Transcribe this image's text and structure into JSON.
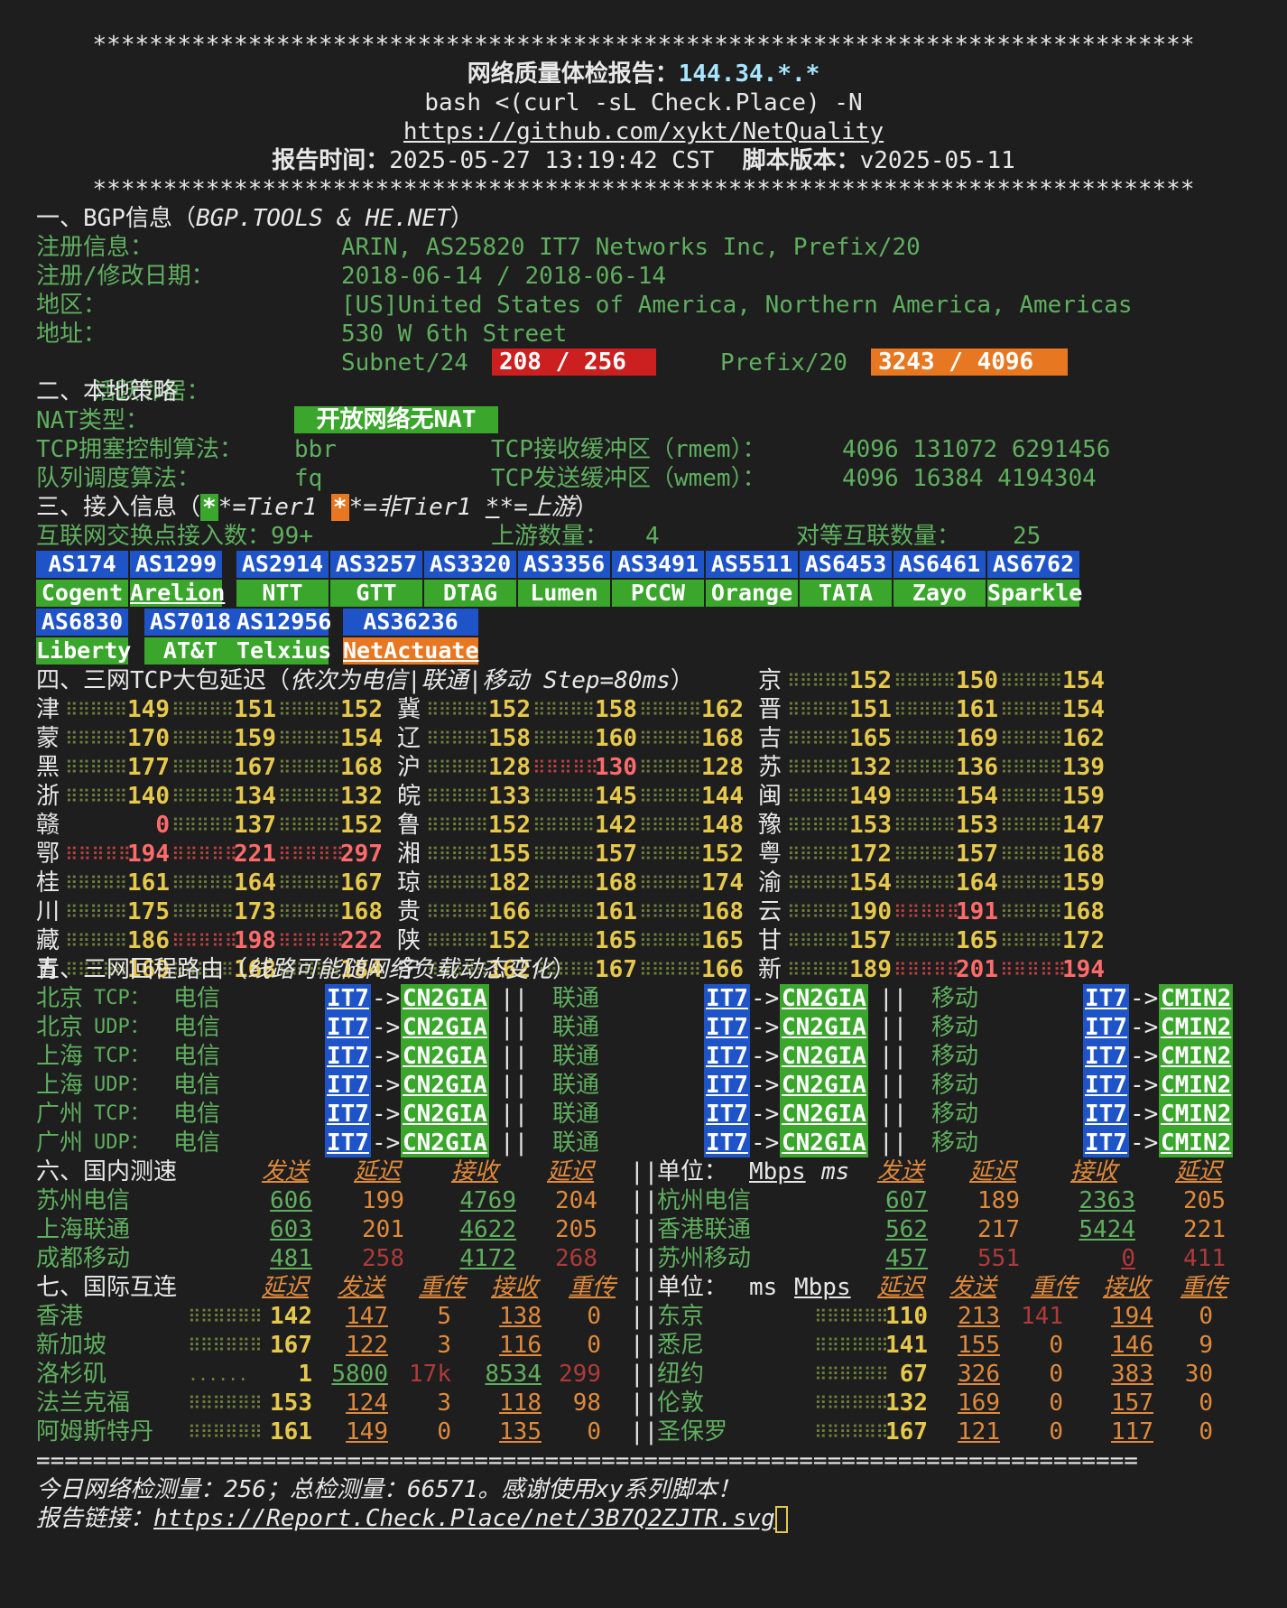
{
  "header": {
    "stars": "******************************************************************************",
    "title": "网络质量体检报告：",
    "ip": "144.34.*.*",
    "command": "bash <(curl -sL Check.Place) -N",
    "repo": "https://github.com/xykt/NetQuality",
    "time_label": "报告时间：",
    "time": "2025-05-27 13:19:42 CST",
    "version_label": "脚本版本：",
    "version": "v2025-05-11"
  },
  "bgp": {
    "title": "一、BGP信息（",
    "source": "BGP.TOOLS & HE.NET",
    "title_end": "）",
    "reg_label": "注册信息：",
    "reg": "ARIN, AS25820 IT7 Networks Inc, Prefix/20",
    "date_label": "注册/修改日期：",
    "date": "2018-06-14 / 2018-06-14",
    "region_label": "地区：",
    "region": "[US]United States of America, Northern America, Americas",
    "addr_label": "地址：",
    "addr": "530 W 6th Street",
    "neighbor_label": "活跃邻居：",
    "subnet_label": "Subnet/24",
    "subnet_val": "208 / 256",
    "prefix_label": "Prefix/20",
    "prefix_val": "3243 / 4096"
  },
  "local": {
    "title": "二、本地策略",
    "nat_label": "NAT类型：",
    "nat": "开放网络无NAT",
    "tcp_cc_label": "TCP拥塞控制算法：",
    "tcp_cc": "bbr",
    "rmem_label": "TCP接收缓冲区（rmem）：",
    "rmem": "4096 131072 6291456",
    "qdisc_label": "队列调度算法：",
    "qdisc": "fq",
    "wmem_label": "TCP发送缓冲区（wmem）：",
    "wmem": "4096 16384 4194304"
  },
  "access": {
    "title": "三、接入信息（",
    "legend_a": "*=Tier1 ",
    "legend_b": "*=非Tier1 ",
    "legend_c": "*=上游",
    "title_end": "）",
    "ix_label": "互联网交换点接入数：",
    "ix": "99+",
    "up_label": "上游数量：",
    "up": "4",
    "peer_label": "对等互联数量：",
    "peer": "25",
    "asns": [
      {
        "as": "AS174",
        "name": "Cogent"
      },
      {
        "as": "AS1299",
        "name": "Arelion"
      },
      {
        "as": "AS2914",
        "name": "NTT"
      },
      {
        "as": "AS3257",
        "name": "GTT"
      },
      {
        "as": "AS3320",
        "name": "DTAG"
      },
      {
        "as": "AS3356",
        "name": "Lumen"
      },
      {
        "as": "AS3491",
        "name": "PCCW"
      },
      {
        "as": "AS5511",
        "name": "Orange"
      },
      {
        "as": "AS6453",
        "name": "TATA"
      },
      {
        "as": "AS6461",
        "name": "Zayo"
      },
      {
        "as": "AS6762",
        "name": "Sparkle"
      },
      {
        "as": "AS6830",
        "name": "Liberty"
      },
      {
        "as": "AS7018",
        "name": "AT&T"
      },
      {
        "as": "AS12956",
        "name": "Telxius"
      },
      {
        "as": "AS36236",
        "name": "NetActuate"
      }
    ]
  },
  "latency": {
    "title": "四、三网TCP大包延迟（",
    "title_it": "依次为电信|联通|移动 Step=80ms",
    "title_end": "）",
    "rows": [
      [
        {
          "p": "京",
          "v": [
            "152",
            "150",
            "154"
          ]
        }
      ],
      [
        {
          "p": "津",
          "v": [
            "149",
            "151",
            "152"
          ]
        },
        {
          "p": "冀",
          "v": [
            "152",
            "158",
            "162"
          ]
        },
        {
          "p": "晋",
          "v": [
            "151",
            "161",
            "154"
          ]
        }
      ],
      [
        {
          "p": "蒙",
          "v": [
            "170",
            "159",
            "154"
          ]
        },
        {
          "p": "辽",
          "v": [
            "158",
            "160",
            "168"
          ]
        },
        {
          "p": "吉",
          "v": [
            "165",
            "169",
            "162"
          ]
        }
      ],
      [
        {
          "p": "黑",
          "v": [
            "177",
            "167",
            "168"
          ]
        },
        {
          "p": "沪",
          "v": [
            "128",
            "130",
            "128"
          ]
        },
        {
          "p": "苏",
          "v": [
            "132",
            "136",
            "139"
          ]
        }
      ],
      [
        {
          "p": "浙",
          "v": [
            "140",
            "134",
            "132"
          ]
        },
        {
          "p": "皖",
          "v": [
            "133",
            "145",
            "144"
          ]
        },
        {
          "p": "闽",
          "v": [
            "149",
            "154",
            "159"
          ]
        }
      ],
      [
        {
          "p": "赣",
          "v": [
            "0",
            "137",
            "152"
          ]
        },
        {
          "p": "鲁",
          "v": [
            "152",
            "142",
            "148"
          ]
        },
        {
          "p": "豫",
          "v": [
            "153",
            "153",
            "147"
          ]
        }
      ],
      [
        {
          "p": "鄂",
          "v": [
            "194",
            "221",
            "297"
          ]
        },
        {
          "p": "湘",
          "v": [
            "155",
            "157",
            "152"
          ]
        },
        {
          "p": "粤",
          "v": [
            "172",
            "157",
            "168"
          ]
        }
      ],
      [
        {
          "p": "桂",
          "v": [
            "161",
            "164",
            "167"
          ]
        },
        {
          "p": "琼",
          "v": [
            "182",
            "168",
            "174"
          ]
        },
        {
          "p": "渝",
          "v": [
            "154",
            "164",
            "159"
          ]
        }
      ],
      [
        {
          "p": "川",
          "v": [
            "175",
            "173",
            "168"
          ]
        },
        {
          "p": "贵",
          "v": [
            "166",
            "161",
            "168"
          ]
        },
        {
          "p": "云",
          "v": [
            "190",
            "191",
            "168"
          ]
        }
      ],
      [
        {
          "p": "藏",
          "v": [
            "186",
            "198",
            "222"
          ]
        },
        {
          "p": "陕",
          "v": [
            "152",
            "165",
            "165"
          ]
        },
        {
          "p": "甘",
          "v": [
            "157",
            "165",
            "172"
          ]
        }
      ],
      [
        {
          "p": "青",
          "v": [
            "169",
            "168",
            "184"
          ]
        },
        {
          "p": "宁",
          "v": [
            "162",
            "167",
            "166"
          ]
        },
        {
          "p": "新",
          "v": [
            "189",
            "201",
            "194"
          ]
        }
      ]
    ]
  },
  "route": {
    "title": "五、三网回程路由（",
    "title_it": "线路可能随网络负载动态变化",
    "title_end": "）",
    "rows": [
      {
        "city": "北京",
        "proto": "TCP："
      },
      {
        "city": "北京",
        "proto": "UDP："
      },
      {
        "city": "上海",
        "proto": "TCP："
      },
      {
        "city": "上海",
        "proto": "UDP："
      },
      {
        "city": "广州",
        "proto": "TCP："
      },
      {
        "city": "广州",
        "proto": "UDP："
      }
    ],
    "ct": "电信",
    "cu": "联通",
    "cm": "移动",
    "it7": "IT7",
    "arrow": "->",
    "cn2": "CN2GIA",
    "cmin2": "CMIN2",
    "sep": "||"
  },
  "domestic": {
    "title": "六、国内测速",
    "h_send": "发送",
    "h_lat": "延迟",
    "h_recv": "接收",
    "h_lat2": "延迟",
    "unit_label": "单位：",
    "unit_a": "Mbps",
    "unit_b": "ms",
    "left": [
      {
        "n": "苏州电信",
        "s": "606",
        "l": "199",
        "r": "4769",
        "l2": "204"
      },
      {
        "n": "上海联通",
        "s": "603",
        "l": "201",
        "r": "4622",
        "l2": "205"
      },
      {
        "n": "成都移动",
        "s": "481",
        "l": "258",
        "r": "4172",
        "l2": "268"
      }
    ],
    "right": [
      {
        "n": "杭州电信",
        "s": "607",
        "l": "189",
        "r": "2363",
        "l2": "205"
      },
      {
        "n": "香港联通",
        "s": "562",
        "l": "217",
        "r": "5424",
        "l2": "221"
      },
      {
        "n": "苏州移动",
        "s": "457",
        "l": "551",
        "r": "0",
        "l2": "411"
      }
    ]
  },
  "intl": {
    "title": "七、国际互连",
    "h_lat": "延迟",
    "h_send": "发送",
    "h_rt": "重传",
    "h_recv": "接收",
    "h_rt2": "重传",
    "unit_label": "单位：",
    "unit_a": "ms",
    "unit_b": "Mbps",
    "left": [
      {
        "n": "香港",
        "lat": "142",
        "s": "147",
        "rt": "5",
        "r": "138",
        "rt2": "0"
      },
      {
        "n": "新加坡",
        "lat": "167",
        "s": "122",
        "rt": "3",
        "r": "116",
        "rt2": "0"
      },
      {
        "n": "洛杉矶",
        "lat": "1",
        "s": "5800",
        "rt": "17k",
        "r": "8534",
        "rt2": "299"
      },
      {
        "n": "法兰克福",
        "lat": "153",
        "s": "124",
        "rt": "3",
        "r": "118",
        "rt2": "98"
      },
      {
        "n": "阿姆斯特丹",
        "lat": "161",
        "s": "149",
        "rt": "0",
        "r": "135",
        "rt2": "0"
      }
    ],
    "right": [
      {
        "n": "东京",
        "lat": "110",
        "s": "213",
        "rt": "141",
        "r": "194",
        "rt2": "0"
      },
      {
        "n": "悉尼",
        "lat": "141",
        "s": "155",
        "rt": "0",
        "r": "146",
        "rt2": "9"
      },
      {
        "n": "纽约",
        "lat": "67",
        "s": "326",
        "rt": "0",
        "r": "383",
        "rt2": "30"
      },
      {
        "n": "伦敦",
        "lat": "132",
        "s": "169",
        "rt": "0",
        "r": "157",
        "rt2": "0"
      },
      {
        "n": "圣保罗",
        "lat": "167",
        "s": "121",
        "rt": "0",
        "r": "117",
        "rt2": "0"
      }
    ]
  },
  "footer": {
    "rule": "==============================================================================",
    "stats": "今日网络检测量：256；总检测量：66571。感谢使用xy系列脚本！",
    "link_label": "报告链接：",
    "link": "https://Report.Check.Place/net/3B7Q2ZJTR.svg"
  },
  "colors": {
    "bg": "#1e1e1e",
    "green": "#5faf5f",
    "yellow": "#e6c84c",
    "red": "#cc1f1f",
    "orange": "#e87722",
    "blue": "#1f54c9",
    "badge_green": "#3aa62c"
  }
}
